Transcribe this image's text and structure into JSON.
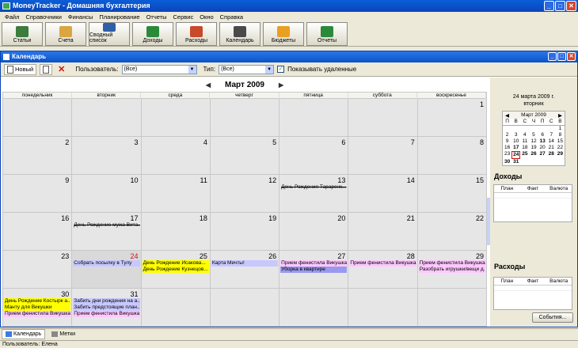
{
  "app": {
    "title": "MoneyTracker - Домашняя бухгалтерия"
  },
  "menu": [
    "Файл",
    "Справочники",
    "Финансы",
    "Планирование",
    "Отчеты",
    "Сервис",
    "Окно",
    "Справка"
  ],
  "toolbar": [
    {
      "label": "Статьи",
      "icon": "articles-icon",
      "color": "#3c7c3c"
    },
    {
      "label": "Счета",
      "icon": "accounts-icon",
      "color": "#d9a640"
    },
    {
      "label": "Сводный список",
      "icon": "summary-list-icon",
      "color": "#2f5fa8"
    },
    {
      "label": "Доходы",
      "icon": "income-icon",
      "color": "#2a8a3a"
    },
    {
      "label": "Расходы",
      "icon": "expenses-icon",
      "color": "#c84a2a"
    },
    {
      "label": "Календарь",
      "icon": "calendar-icon",
      "color": "#4a4a4a"
    },
    {
      "label": "Бюджеты",
      "icon": "budgets-icon",
      "color": "#e8a020"
    },
    {
      "label": "Отчеты",
      "icon": "reports-icon",
      "color": "#2a8a3a"
    }
  ],
  "calendar_window": {
    "title": "Календарь",
    "new_label": "Новый",
    "user_label": "Пользователь:",
    "user_value": "(Все)",
    "type_label": "Тип:",
    "type_value": "(Все)",
    "show_deleted_label": "Показывать удаленные",
    "show_deleted_checked": true
  },
  "month_title": "Март 2009",
  "weekdays": [
    "понедельник",
    "вторник",
    "среда",
    "четверг",
    "пятница",
    "суббота",
    "воскресенье"
  ],
  "weeks": [
    [
      {
        "d": ""
      },
      {
        "d": ""
      },
      {
        "d": ""
      },
      {
        "d": ""
      },
      {
        "d": ""
      },
      {
        "d": ""
      },
      {
        "d": "1"
      }
    ],
    [
      {
        "d": "2"
      },
      {
        "d": "3"
      },
      {
        "d": "4"
      },
      {
        "d": "5"
      },
      {
        "d": "6"
      },
      {
        "d": "7"
      },
      {
        "d": "8"
      }
    ],
    [
      {
        "d": "9"
      },
      {
        "d": "10"
      },
      {
        "d": "11"
      },
      {
        "d": "12"
      },
      {
        "d": "13",
        "events": [
          {
            "t": "День Рождения Тараренк...",
            "c": "white"
          }
        ]
      },
      {
        "d": "14"
      },
      {
        "d": "15"
      }
    ],
    [
      {
        "d": "16"
      },
      {
        "d": "17",
        "events": [
          {
            "t": "День Рождение мужа Вита...",
            "c": "white"
          }
        ]
      },
      {
        "d": "18"
      },
      {
        "d": "19"
      },
      {
        "d": "20"
      },
      {
        "d": "21"
      },
      {
        "d": "22"
      }
    ],
    [
      {
        "d": "23"
      },
      {
        "d": "24",
        "today": true,
        "events": [
          {
            "t": "Собрать посылку в Тулу",
            "c": "lblue"
          }
        ]
      },
      {
        "d": "25",
        "events": [
          {
            "t": "День Рождение Исакова...",
            "c": "yellow"
          },
          {
            "t": "День Рождение Кузнецов...",
            "c": "yellow"
          }
        ]
      },
      {
        "d": "26",
        "events": [
          {
            "t": "Карта Мечты!",
            "c": "lblue"
          }
        ]
      },
      {
        "d": "27",
        "events": [
          {
            "t": "Прием фенистила Викушка",
            "c": "pink"
          },
          {
            "t": "Уборка в квартире",
            "c": "blue"
          }
        ]
      },
      {
        "d": "28",
        "events": [
          {
            "t": "Прием фенистила Викушка",
            "c": "pink"
          }
        ]
      },
      {
        "d": "29",
        "events": [
          {
            "t": "Прием фенистила Викушка",
            "c": "pink"
          },
          {
            "t": "Разобрать игрушки/вещи д...",
            "c": "pink"
          }
        ]
      }
    ],
    [
      {
        "d": "30",
        "events": [
          {
            "t": "День Рождение Костырк а...",
            "c": "yellow"
          },
          {
            "t": "Манту для Викушки",
            "c": "yellow"
          },
          {
            "t": "Прием фенистила Викушка",
            "c": "pink"
          }
        ]
      },
      {
        "d": "31",
        "events": [
          {
            "t": "Забить дни рождения на а...",
            "c": "lblue"
          },
          {
            "t": "Забить предстоящие план...",
            "c": "lblue"
          },
          {
            "t": "Прием фенистила Викушка",
            "c": "pink"
          }
        ]
      },
      {
        "d": ""
      },
      {
        "d": ""
      },
      {
        "d": ""
      },
      {
        "d": ""
      },
      {
        "d": ""
      }
    ]
  ],
  "sidebar": {
    "date_line1": "24 марта 2009 г.",
    "date_line2": "вторник",
    "mini_month": "Март 2009",
    "mini_weekdays": [
      "П",
      "В",
      "С",
      "Ч",
      "П",
      "С",
      "В"
    ],
    "mini_days": [
      [
        "",
        "",
        "",
        "",
        "",
        "",
        "1"
      ],
      [
        "2",
        "3",
        "4",
        "5",
        "6",
        "7",
        "8"
      ],
      [
        "9",
        "10",
        "11",
        "12",
        "13",
        "14",
        "15"
      ],
      [
        "16",
        "17",
        "18",
        "19",
        "20",
        "21",
        "22"
      ],
      [
        "23",
        "24",
        "25",
        "26",
        "27",
        "28",
        "29"
      ],
      [
        "30",
        "31",
        "",
        "",
        "",
        "",
        ""
      ]
    ],
    "income_title": "Доходы",
    "expense_title": "Расходы",
    "table_cols": [
      "План",
      "Факт",
      "Валюта"
    ],
    "events_button": "События..."
  },
  "bottom_tabs": [
    "Календарь",
    "Метки"
  ],
  "status": "Пользователь: Елена"
}
